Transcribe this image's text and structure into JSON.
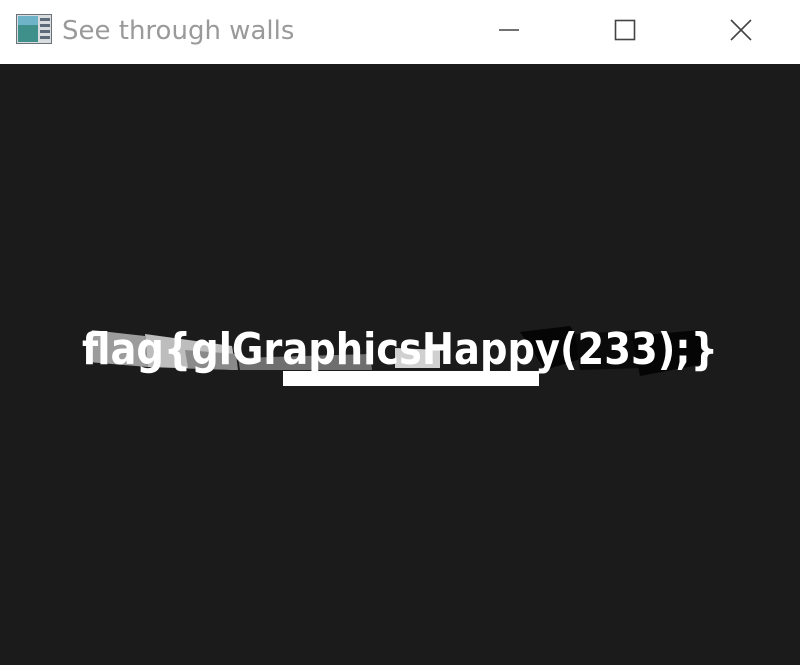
{
  "window": {
    "title": "See through walls",
    "controls": {
      "minimize_icon": "minimize-icon",
      "maximize_icon": "maximize-icon",
      "close_icon": "close-icon"
    }
  },
  "canvas": {
    "background": "#1b1b1b",
    "flag_text": "flag{glGraphicsHappy(233);}"
  }
}
